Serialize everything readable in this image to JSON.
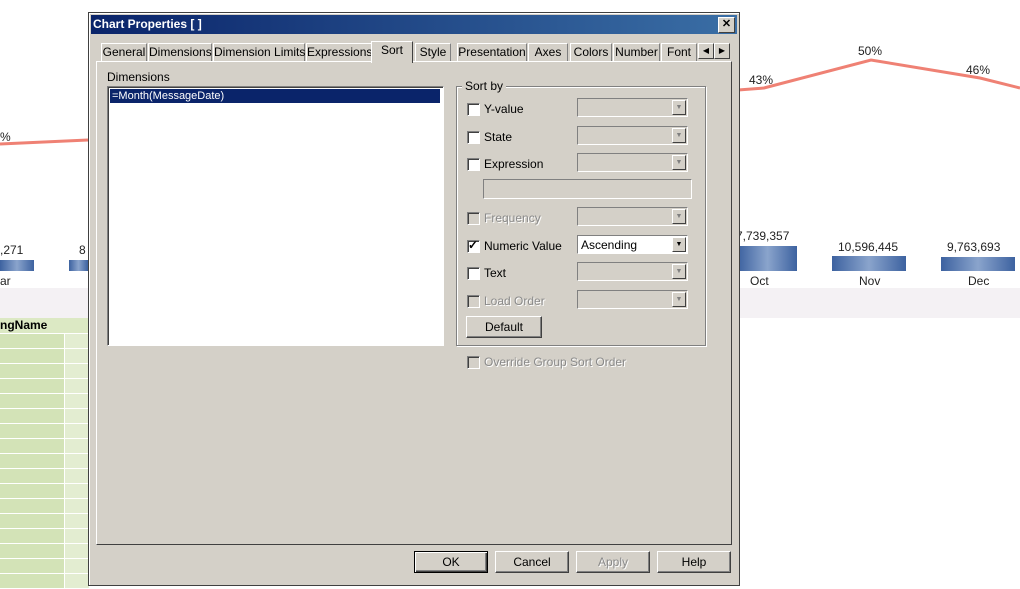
{
  "background": {
    "pct_labels": [
      {
        "text": "%"
      },
      {
        "text": "43%"
      },
      {
        "text": "50%"
      },
      {
        "text": "46%"
      }
    ],
    "value_labels": [
      {
        "text": ",271"
      },
      {
        "text": "8"
      },
      {
        "text": "7,739,357"
      },
      {
        "text": "10,596,445"
      },
      {
        "text": "9,763,693"
      }
    ],
    "month_labels": [
      {
        "text": "ar"
      },
      {
        "text": "Oct"
      },
      {
        "text": "Nov"
      },
      {
        "text": "Dec"
      }
    ],
    "grid_header": "ngName",
    "colors": {
      "line": "#ef8174",
      "bar": "#5d7fb3",
      "grid_row": "#d3e3b7"
    }
  },
  "dialog": {
    "title": "Chart Properties [ ]",
    "close_glyph": "✕",
    "tabs": [
      "General",
      "Dimensions",
      "Dimension Limits",
      "Expressions",
      "Sort",
      "Style",
      "Presentation",
      "Axes",
      "Colors",
      "Number",
      "Font"
    ],
    "active_tab": "Sort",
    "tab_scroll_left": "◀",
    "tab_scroll_right": "▶",
    "dimensions_label": "Dimensions",
    "dimensions": [
      "=Month(MessageDate)"
    ],
    "sort_by_label": "Sort by",
    "sort_options": [
      {
        "label": "Y-value",
        "checked": false,
        "enabled": true,
        "value": ""
      },
      {
        "label": "State",
        "checked": false,
        "enabled": true,
        "value": ""
      },
      {
        "label": "Expression",
        "checked": false,
        "enabled": true,
        "value": ""
      },
      {
        "label": "Frequency",
        "checked": false,
        "enabled": false,
        "value": ""
      },
      {
        "label": "Numeric Value",
        "checked": true,
        "enabled": true,
        "value": "Ascending"
      },
      {
        "label": "Text",
        "checked": false,
        "enabled": true,
        "value": ""
      },
      {
        "label": "Load Order",
        "checked": false,
        "enabled": false,
        "value": ""
      }
    ],
    "expression_value": "",
    "default_button": "Default",
    "override_label": "Override Group Sort Order",
    "buttons": {
      "ok": "OK",
      "cancel": "Cancel",
      "apply": "Apply",
      "help": "Help"
    },
    "check_glyph": "✓",
    "dropdown_glyph": "▼"
  }
}
